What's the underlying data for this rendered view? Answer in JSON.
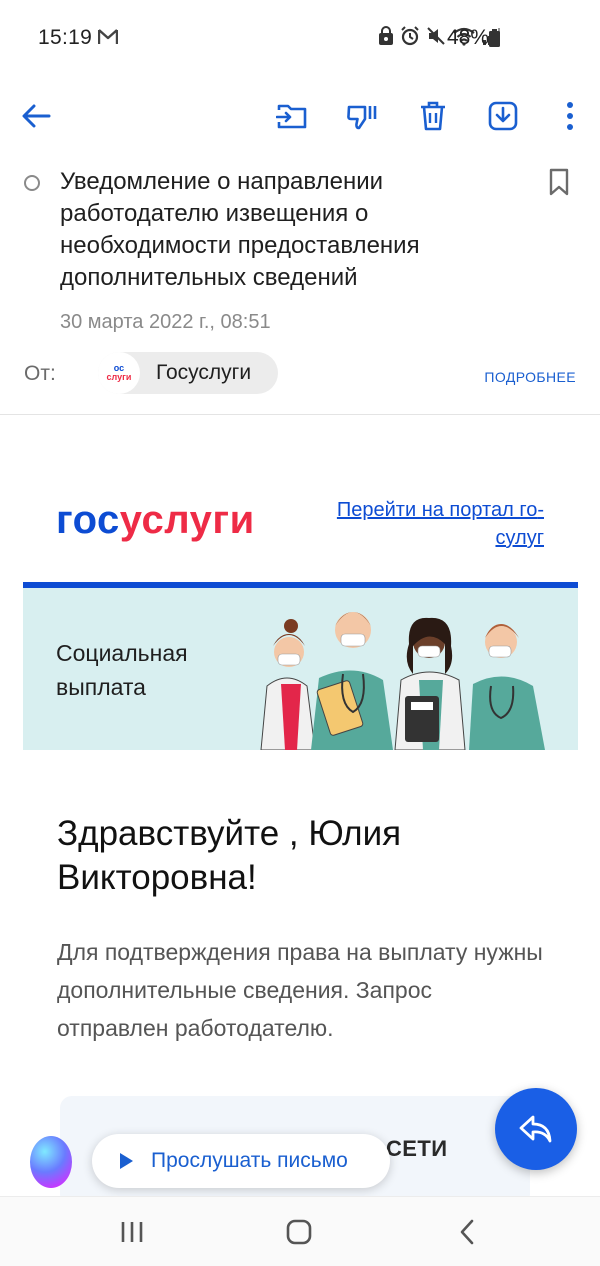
{
  "status": {
    "time": "15:19",
    "battery": "48%"
  },
  "toolbar": {
    "back": "back-arrow-icon",
    "move": "move-to-folder-icon",
    "spam": "thumbs-down-icon",
    "delete": "trash-icon",
    "save": "download-icon",
    "more": "more-vert-icon"
  },
  "email": {
    "subject": "Уведомление о направлении работодателю извещения о необходимости предоставления дополнительных сведений",
    "date": "30 марта 2022 г., 08:51",
    "from_label": "От:",
    "sender_logo_top": "ос",
    "sender_logo_bottom": "слуги",
    "sender_name": "Госуслуги",
    "details_link": "ПОДРОБНЕЕ"
  },
  "content": {
    "brand_left": "гос",
    "brand_right": "услуги",
    "portal_link": "Перейти на портал го­сулуг",
    "banner_text": "Социальная выплата",
    "greeting": "Здравствуйте , Юлия Викторовна!",
    "body": "Для подтверждения права на выплату нужны дополнительные сведения. Запрос отправлен работодателю.",
    "card_title": "СЕТИ",
    "card_sub": ""
  },
  "bottom": {
    "listen_label": "Прослушать письмо"
  },
  "colors": {
    "accent": "#1a5fd0",
    "brand_blue": "#0d4cd3",
    "brand_red": "#ee2b46",
    "banner_bg": "#d8eff0"
  }
}
